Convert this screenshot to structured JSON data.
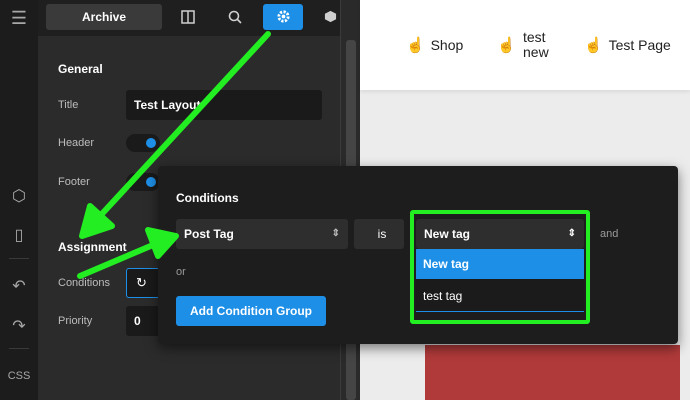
{
  "toolbar": {
    "archive_label": "Archive"
  },
  "rail": {
    "css_label": "CSS"
  },
  "general": {
    "title": "General",
    "title_label": "Title",
    "title_value": "Test Layout",
    "header_label": "Header",
    "footer_label": "Footer"
  },
  "assignment": {
    "title": "Assignment",
    "conditions_label": "Conditions",
    "priority_label": "Priority",
    "priority_value": "0"
  },
  "nav": {
    "items": [
      {
        "label": "Shop"
      },
      {
        "label_line1": "test",
        "label_line2": "new"
      },
      {
        "label": "Test Page"
      }
    ]
  },
  "conditions": {
    "title": "Conditions",
    "field": "Post Tag",
    "operator": "is",
    "value": "New tag",
    "and_label": "and",
    "or_label": "or",
    "add_group": "Add Condition Group",
    "options": [
      "New tag",
      "test tag"
    ]
  },
  "colors": {
    "accent": "#1e8fe6",
    "highlight": "#22ee22",
    "red_block": "#b03a3a"
  }
}
